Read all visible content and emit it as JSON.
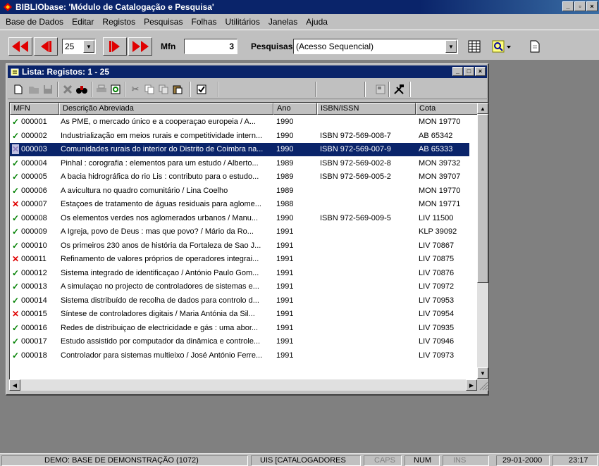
{
  "app": {
    "title": "BIBLIObase: 'Módulo de Catalogação e Pesquisa'"
  },
  "menu": [
    "Base de Dados",
    "Editar",
    "Registos",
    "Pesquisas",
    "Folhas",
    "Utilitários",
    "Janelas",
    "Ajuda"
  ],
  "toolbar": {
    "page_size": "25",
    "mfn_label": "Mfn",
    "mfn_value": "3",
    "search_label": "Pesquisas",
    "search_mode": "(Acesso Sequencial)"
  },
  "list_window": {
    "title": "Lista: Registos: 1 - 25",
    "columns": [
      "MFN",
      "Descrição Abreviada",
      "Ano",
      "ISBN/ISSN",
      "Cota"
    ],
    "selected_row": 2,
    "rows": [
      {
        "status": "ok",
        "mfn": "000001",
        "desc": "As PME, o mercado único e a cooperaçao europeia / A...",
        "ano": "1990",
        "isbn": "",
        "cota": "MON 19770"
      },
      {
        "status": "ok",
        "mfn": "000002",
        "desc": "Industrialização em meios rurais e competitividade intern...",
        "ano": "1990",
        "isbn": "ISBN 972-569-008-7",
        "cota": "AB 65342"
      },
      {
        "status": "locked",
        "mfn": "000003",
        "desc": "Comunidades rurais do interior do Distrito de Coimbra na...",
        "ano": "1990",
        "isbn": "ISBN 972-569-007-9",
        "cota": "AB 65333"
      },
      {
        "status": "ok",
        "mfn": "000004",
        "desc": "Pinhal : corografia : elementos para um estudo / Alberto...",
        "ano": "1989",
        "isbn": "ISBN 972-569-002-8",
        "cota": "MON 39732"
      },
      {
        "status": "ok",
        "mfn": "000005",
        "desc": "A bacia hidrográfica do rio Lis : contributo para o estudo...",
        "ano": "1989",
        "isbn": "ISBN 972-569-005-2",
        "cota": "MON 39707"
      },
      {
        "status": "ok",
        "mfn": "000006",
        "desc": "A avicultura no quadro comunitário / Lina Coelho",
        "ano": "1989",
        "isbn": "",
        "cota": "MON 19770"
      },
      {
        "status": "deleted",
        "mfn": "000007",
        "desc": "Estaçoes de tratamento de águas residuais para aglome...",
        "ano": "1988",
        "isbn": "",
        "cota": "MON 19771"
      },
      {
        "status": "ok",
        "mfn": "000008",
        "desc": "Os elementos verdes nos aglomerados urbanos / Manu...",
        "ano": "1990",
        "isbn": "ISBN 972-569-009-5",
        "cota": "LIV 11500"
      },
      {
        "status": "ok",
        "mfn": "000009",
        "desc": "A Igreja, povo de Deus : mas que povo? / Mário da Ro...",
        "ano": "1991",
        "isbn": "",
        "cota": "KLP 39092"
      },
      {
        "status": "ok",
        "mfn": "000010",
        "desc": "Os primeiros 230 anos de história da Fortaleza de Sao J...",
        "ano": "1991",
        "isbn": "",
        "cota": "LIV 70867"
      },
      {
        "status": "deleted",
        "mfn": "000011",
        "desc": "Refinamento de valores próprios de operadores integrai...",
        "ano": "1991",
        "isbn": "",
        "cota": "LIV 70875"
      },
      {
        "status": "ok",
        "mfn": "000012",
        "desc": "Sistema integrado de identificaçao / António Paulo Gom...",
        "ano": "1991",
        "isbn": "",
        "cota": "LIV 70876"
      },
      {
        "status": "ok",
        "mfn": "000013",
        "desc": "A simulaçao no projecto de controladores de sistemas e...",
        "ano": "1991",
        "isbn": "",
        "cota": "LIV 70972"
      },
      {
        "status": "ok",
        "mfn": "000014",
        "desc": "Sistema distribuído de recolha de dados para controlo d...",
        "ano": "1991",
        "isbn": "",
        "cota": "LIV 70953"
      },
      {
        "status": "deleted",
        "mfn": "000015",
        "desc": "Síntese de controladores digitais / Maria Antónia da Sil...",
        "ano": "1991",
        "isbn": "",
        "cota": "LIV 70954"
      },
      {
        "status": "ok",
        "mfn": "000016",
        "desc": "Redes de distribuiçao de electricidade e gás : uma abor...",
        "ano": "1991",
        "isbn": "",
        "cota": "LIV 70935"
      },
      {
        "status": "ok",
        "mfn": "000017",
        "desc": "Estudo assistido por computador da dinâmica e controle...",
        "ano": "1991",
        "isbn": "",
        "cota": "LIV 70946"
      },
      {
        "status": "ok",
        "mfn": "000018",
        "desc": "Controlador para sistemas multieixo / José António Ferre...",
        "ano": "1991",
        "isbn": "",
        "cota": "LIV 70973"
      }
    ]
  },
  "status": {
    "database": "DEMO: BASE DE DEMONSTRAÇÃO  (1072)",
    "user": "UIS  [CATALOGADORES",
    "caps": "CAPS",
    "num": "NUM",
    "ins": "INS",
    "date": "29-01-2000",
    "time": "23:17"
  },
  "colors": {
    "ok": "#008000",
    "deleted": "#e00000",
    "locked": "#9080c0",
    "selection": "#0a246a",
    "nav_arrow": "#e00000"
  },
  "icons": [
    "app-icon",
    "first-icon",
    "prev-icon",
    "next-icon",
    "last-icon",
    "list-icon",
    "query-icon",
    "document-icon",
    "new-icon",
    "edit-icon",
    "save-icon",
    "delete-icon",
    "find-icon",
    "print-icon",
    "refresh-icon",
    "cut-icon",
    "copy-icon",
    "paste-icon",
    "check-icon",
    "properties-icon",
    "tools-icon"
  ]
}
